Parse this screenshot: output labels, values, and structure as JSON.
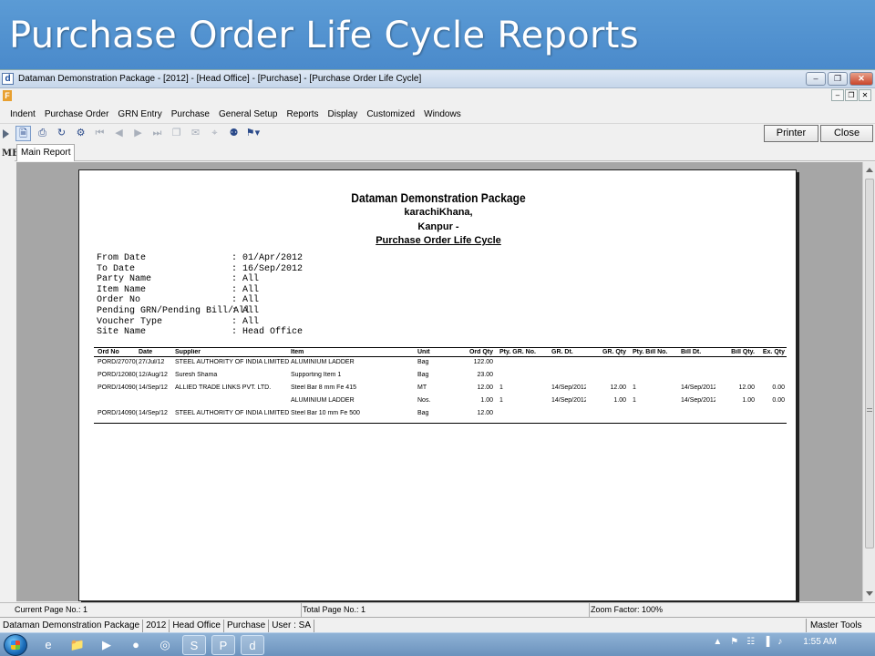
{
  "slide": {
    "title": "Purchase Order Life Cycle Reports"
  },
  "window": {
    "app_icon": "d",
    "title": "Dataman Demonstration Package - [2012] - [Head Office] - [Purchase] - [Purchase Order Life Cycle]",
    "mdi_icon": "F"
  },
  "menu": {
    "items": [
      "Indent",
      "Purchase Order",
      "GRN Entry",
      "Purchase",
      "General Setup",
      "Reports",
      "Display",
      "Customized",
      "Windows"
    ]
  },
  "toolbar": {
    "icons": [
      "export-icon",
      "print-icon",
      "refresh-icon",
      "setup-icon",
      "first-page-icon",
      "prev-page-icon",
      "next-page-icon",
      "last-page-icon",
      "goto-page-icon",
      "mail-icon",
      "zoom-icon",
      "find-icon",
      "binoculars-icon"
    ],
    "printer_label": "Printer",
    "close_label": "Close"
  },
  "side_menu": {
    "label": "MENU"
  },
  "tabs": {
    "main_report": "Main Report"
  },
  "report": {
    "company": "Dataman Demonstration Package",
    "address_line1": "karachiKhana,",
    "address_line2": "Kanpur -",
    "title": "Purchase Order Life Cycle",
    "filters": [
      {
        "label": "From Date",
        "value": ": 01/Apr/2012"
      },
      {
        "label": "To Date",
        "value": ": 16/Sep/2012"
      },
      {
        "label": "Party Name",
        "value": ": All"
      },
      {
        "label": "Item Name",
        "value": ": All"
      },
      {
        "label": "Order No",
        "value": ": All"
      },
      {
        "label": "Pending GRN/Pending Bill/All",
        "value": ": All"
      },
      {
        "label": "Voucher Type",
        "value": ": All"
      },
      {
        "label": "Site Name",
        "value": ": Head Office"
      }
    ],
    "columns": [
      "Ord No",
      "Date",
      "Supplier",
      "Item",
      "Unit",
      "Ord Qty",
      "Pty. GR. No.",
      "GR. Dt.",
      "GR. Qty",
      "Pty. Bill No.",
      "Bill Dt.",
      "Bill Qty.",
      "Ex. Qty"
    ],
    "rows": [
      [
        "PORD/27070(",
        "27/Jul/12",
        "STEEL AUTHORITY OF INDIA LIMITED",
        "ALUMINIUM LADDER",
        "Bag",
        "122.00",
        "",
        "",
        "",
        "",
        "",
        "",
        ""
      ],
      [
        "PORD/12080(",
        "12/Aug/12",
        "Suresh Shama",
        "Supporting Item 1",
        "Bag",
        "23.00",
        "",
        "",
        "",
        "",
        "",
        "",
        ""
      ],
      [
        "PORD/14090(",
        "14/Sep/12",
        "ALLIED TRADE LINKS PVT. LTD.",
        "Steel Bar 8 mm Fe 415",
        "MT",
        "12.00",
        "1",
        "14/Sep/2012",
        "12.00",
        "1",
        "14/Sep/2012",
        "12.00",
        "0.00"
      ],
      [
        "",
        "",
        "",
        "ALUMINIUM LADDER",
        "Nos.",
        "1.00",
        "1",
        "14/Sep/2012",
        "1.00",
        "1",
        "14/Sep/2012",
        "1.00",
        "0.00"
      ],
      [
        "PORD/14090(",
        "14/Sep/12",
        "STEEL AUTHORITY OF INDIA LIMITED",
        "Steel Bar 10 mm Fe 500",
        "Bag",
        "12.00",
        "",
        "",
        "",
        "",
        "",
        "",
        ""
      ]
    ]
  },
  "status": {
    "current_page": "Current Page No.: 1",
    "total_page": "Total Page No.: 1",
    "zoom": "Zoom Factor: 100%"
  },
  "app_status": {
    "segments": [
      "Dataman Demonstration Package",
      "2012",
      "Head Office",
      "Purchase",
      "User : SA"
    ],
    "master_tools": "Master Tools"
  },
  "taskbar": {
    "apps": [
      "ie-icon",
      "explorer-icon",
      "media-player-icon",
      "firefox-icon",
      "chrome-icon",
      "skype-icon",
      "powerpoint-icon",
      "dataman-icon"
    ],
    "clock": "1:55 AM"
  }
}
